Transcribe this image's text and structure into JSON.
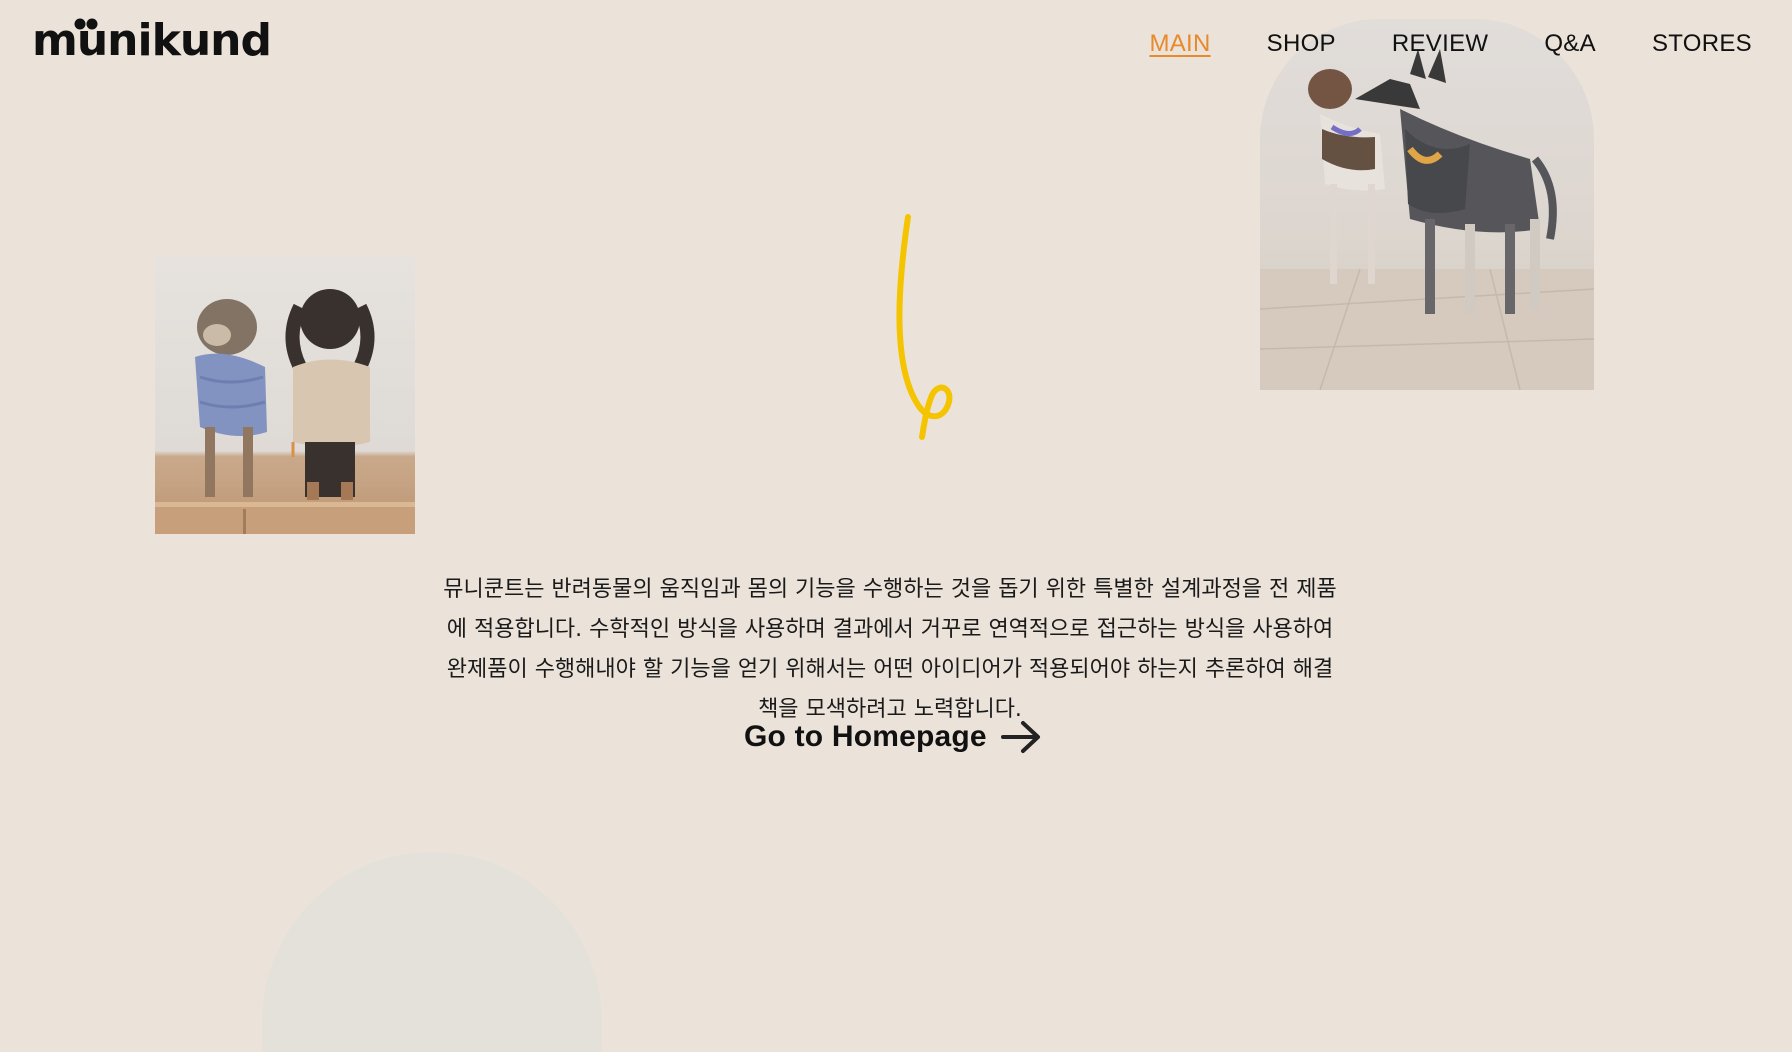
{
  "brand": {
    "logo_text": "munikund",
    "accent_color": "#e8892c",
    "background_color": "#ebe2d9"
  },
  "nav": {
    "items": [
      {
        "label": "MAIN",
        "active": true
      },
      {
        "label": "SHOP",
        "active": false
      },
      {
        "label": "REVIEW",
        "active": false
      },
      {
        "label": "Q&A",
        "active": false
      },
      {
        "label": "STORES",
        "active": false
      }
    ]
  },
  "main": {
    "intro_text": "뮤니쿤트는 반려동물의 움직임과 몸의 기능을 수행하는 것을 돕기 위한 특별한 설계과정을 전 제품에 적용합니다. 수학적인 방식을 사용하며 결과에서 거꾸로 연역적으로 접근하는 방식을 사용하여 완제품이 수행해내야 할 기능을 얻기 위해서는 어떤 아이디어가 적용되어야 하는지 추론하여 해결책을 모색하려고 노력합니다.",
    "cta_label": "Go to Homepage",
    "cta_icon": "arrow-right-icon",
    "squiggle_color": "#f5c400"
  }
}
